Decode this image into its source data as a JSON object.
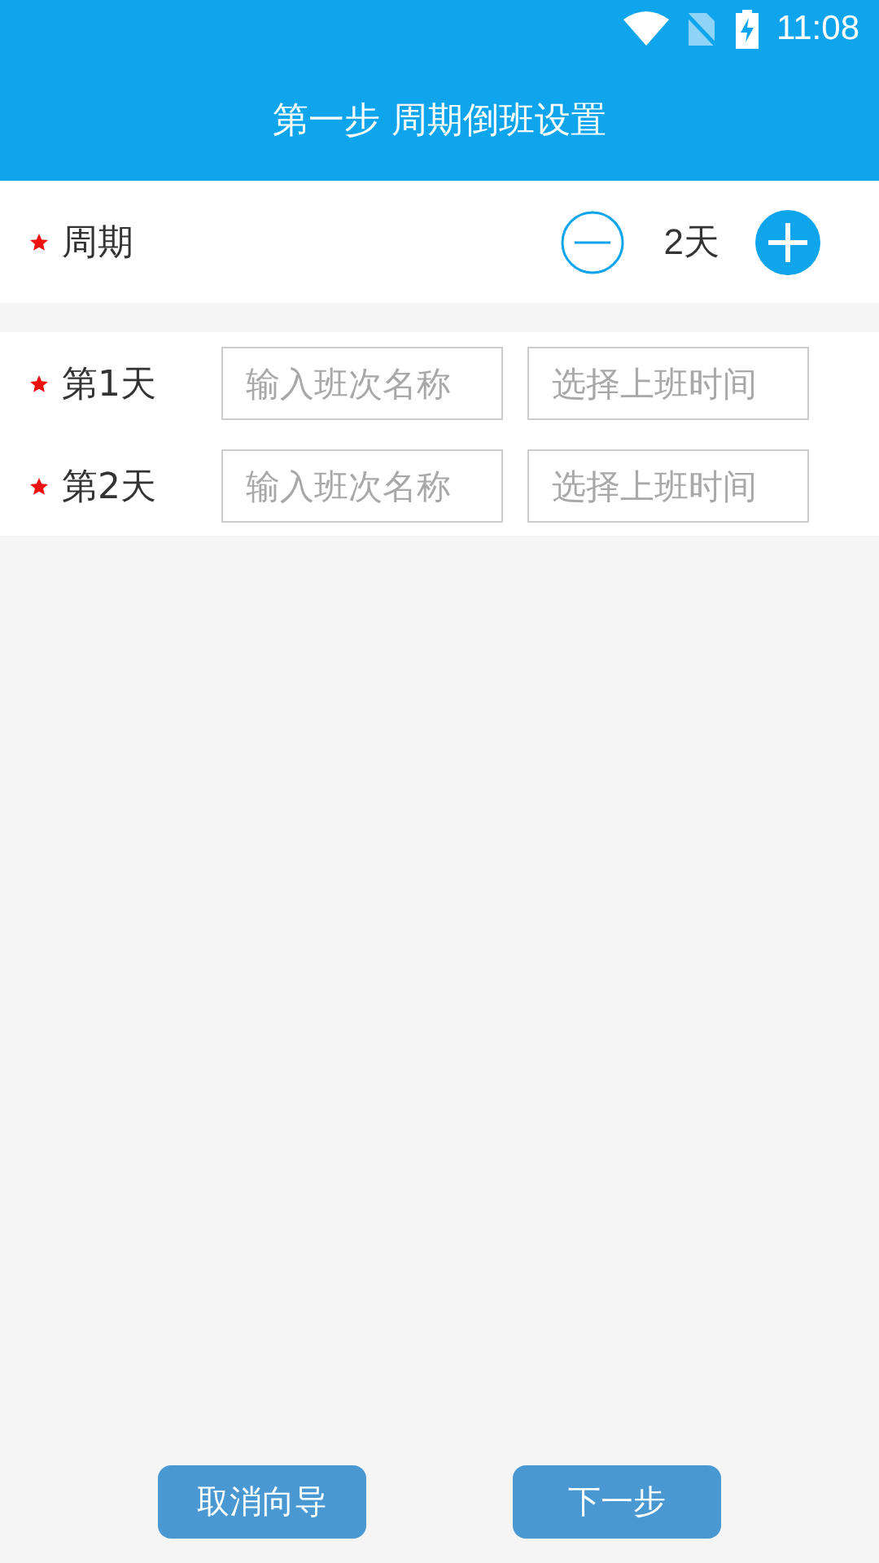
{
  "status_bar": {
    "time": "11:08"
  },
  "header": {
    "title": "第一步 周期倒班设置"
  },
  "period": {
    "label": "周期",
    "required": true,
    "value": "2天"
  },
  "days": [
    {
      "label": "第1天",
      "required": true,
      "name_placeholder": "输入班次名称",
      "time_placeholder": "选择上班时间"
    },
    {
      "label": "第2天",
      "required": true,
      "name_placeholder": "输入班次名称",
      "time_placeholder": "选择上班时间"
    }
  ],
  "buttons": [
    {
      "label": "取消向导"
    },
    {
      "label": "下一步"
    }
  ]
}
